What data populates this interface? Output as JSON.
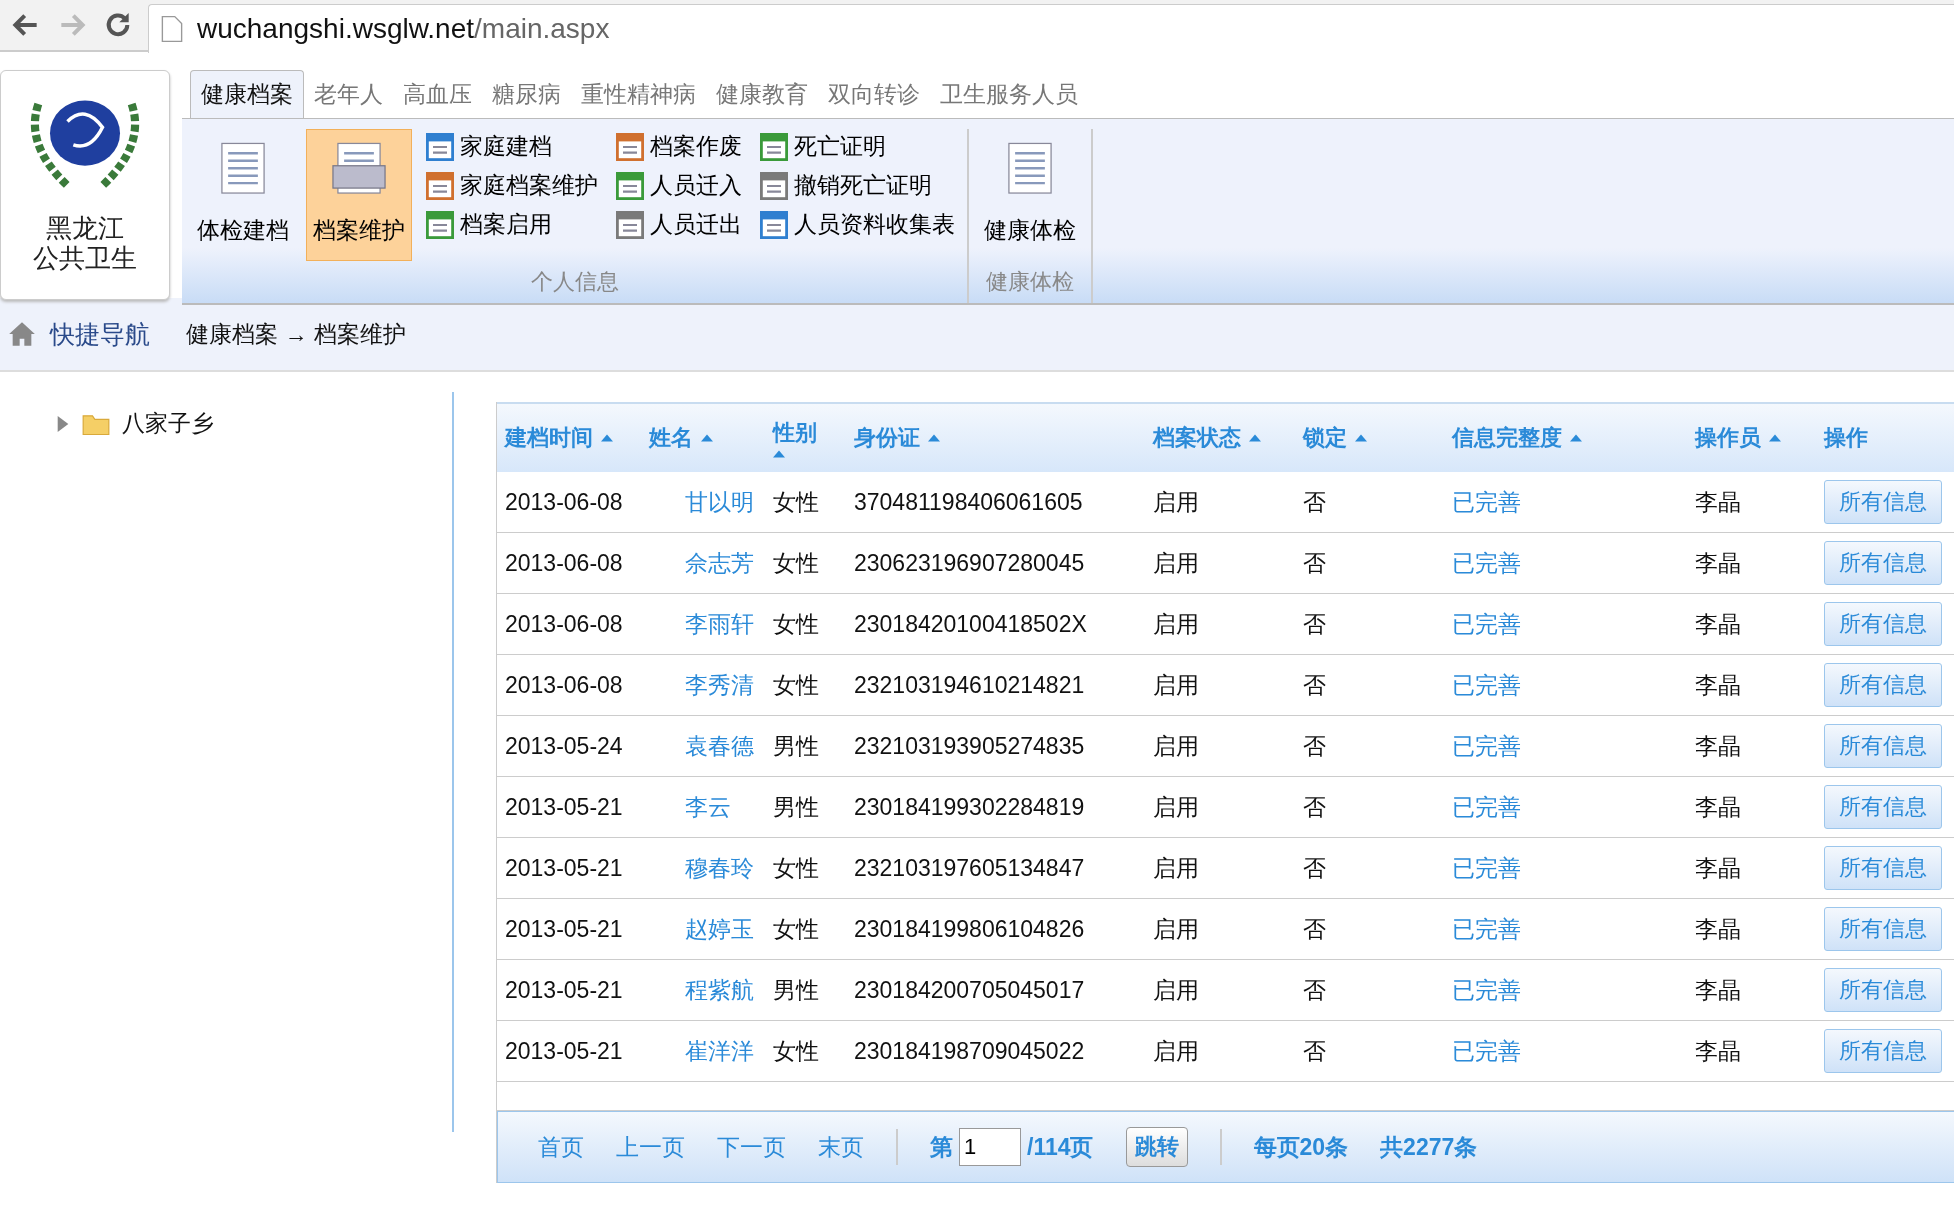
{
  "browser": {
    "url_host": "wuchangshi.wsglw.net",
    "url_path": "/main.aspx",
    "forward_disabled": true
  },
  "logo_text": [
    "黑龙江",
    "公共卫生"
  ],
  "tabs": [
    {
      "label": "健康档案",
      "selected": true
    },
    {
      "label": "老年人",
      "selected": false
    },
    {
      "label": "高血压",
      "selected": false
    },
    {
      "label": "糖尿病",
      "selected": false
    },
    {
      "label": "重性精神病",
      "selected": false
    },
    {
      "label": "健康教育",
      "selected": false
    },
    {
      "label": "双向转诊",
      "selected": false
    },
    {
      "label": "卫生服务人员",
      "selected": false
    }
  ],
  "ribbon_groups": [
    {
      "title": "个人信息",
      "big_buttons": [
        {
          "label": "体检建档",
          "selected": false
        },
        {
          "label": "档案维护",
          "selected": true
        }
      ],
      "small_columns": [
        [
          "家庭建档",
          "家庭档案维护",
          "档案启用"
        ],
        [
          "档案作废",
          "人员迁入",
          "人员迁出"
        ],
        [
          "死亡证明",
          "撤销死亡证明",
          "人员资料收集表"
        ]
      ]
    },
    {
      "title": "健康体检",
      "big_buttons": [
        {
          "label": "健康体检",
          "selected": false
        }
      ]
    }
  ],
  "nav": {
    "label": "快捷导航",
    "breadcrumb": "健康档案 → 档案维护"
  },
  "tree": [
    {
      "label": "八家子乡",
      "expanded": false
    }
  ],
  "table": {
    "columns": [
      {
        "label": "建档时间",
        "sortable": true
      },
      {
        "label": "姓名",
        "sortable": true
      },
      {
        "label": "性别",
        "sortable": true
      },
      {
        "label": "身份证",
        "sortable": true
      },
      {
        "label": "档案状态",
        "sortable": true
      },
      {
        "label": "锁定",
        "sortable": true
      },
      {
        "label": "信息完整度",
        "sortable": true
      },
      {
        "label": "操作员",
        "sortable": true
      },
      {
        "label": "操作",
        "sortable": false
      }
    ],
    "rows": [
      [
        "2013-06-08",
        "甘以明",
        "女性",
        "370481198406061605",
        "启用",
        "否",
        "已完善",
        "李晶",
        "所有信息"
      ],
      [
        "2013-06-08",
        "佘志芳",
        "女性",
        "230623196907280045",
        "启用",
        "否",
        "已完善",
        "李晶",
        "所有信息"
      ],
      [
        "2013-06-08",
        "李雨轩",
        "女性",
        "23018420100418502X",
        "启用",
        "否",
        "已完善",
        "李晶",
        "所有信息"
      ],
      [
        "2013-06-08",
        "李秀清",
        "女性",
        "232103194610214821",
        "启用",
        "否",
        "已完善",
        "李晶",
        "所有信息"
      ],
      [
        "2013-05-24",
        "袁春德",
        "男性",
        "232103193905274835",
        "启用",
        "否",
        "已完善",
        "李晶",
        "所有信息"
      ],
      [
        "2013-05-21",
        "李云",
        "男性",
        "230184199302284819",
        "启用",
        "否",
        "已完善",
        "李晶",
        "所有信息"
      ],
      [
        "2013-05-21",
        "穆春玲",
        "女性",
        "232103197605134847",
        "启用",
        "否",
        "已完善",
        "李晶",
        "所有信息"
      ],
      [
        "2013-05-21",
        "赵婷玉",
        "女性",
        "230184199806104826",
        "启用",
        "否",
        "已完善",
        "李晶",
        "所有信息"
      ],
      [
        "2013-05-21",
        "程紫航",
        "男性",
        "230184200705045017",
        "启用",
        "否",
        "已完善",
        "李晶",
        "所有信息"
      ],
      [
        "2013-05-21",
        "崔洋洋",
        "女性",
        "230184198709045022",
        "启用",
        "否",
        "已完善",
        "李晶",
        "所有信息"
      ]
    ]
  },
  "pager": {
    "links": [
      "首页",
      "上一页",
      "下一页",
      "末页"
    ],
    "page_prefix": "第",
    "page_value": "1",
    "page_suffix": "/114页",
    "go": "跳转",
    "per_page": "每页20条",
    "total": "共2277条"
  }
}
